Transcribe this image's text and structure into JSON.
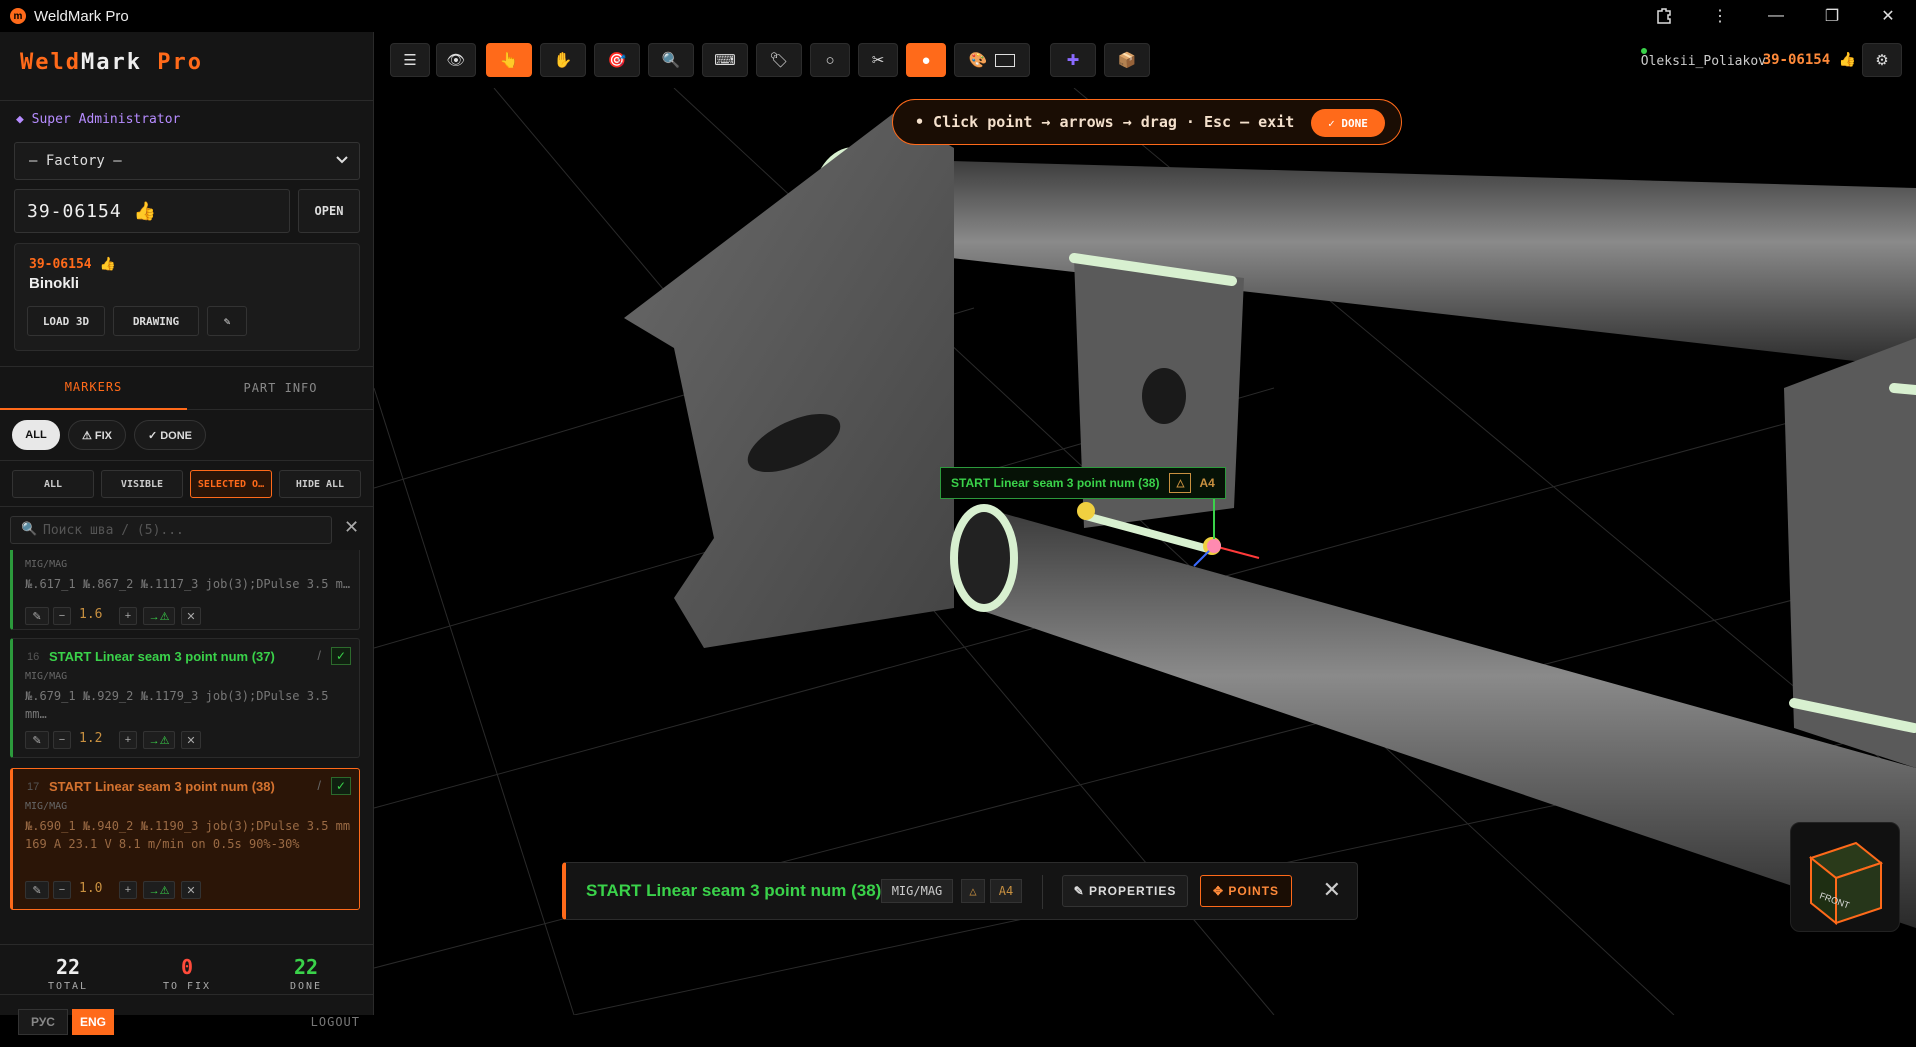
{
  "window": {
    "title": "WeldMark Pro",
    "controls": [
      "minimize",
      "maximize",
      "close"
    ]
  },
  "sidebar": {
    "brand": {
      "part1": "Weld",
      "part2": "Mark",
      "part3": " Pro"
    },
    "role": "◆ Super Administrator",
    "factory_select": "— Factory —",
    "order_input": "39-06154 👍",
    "open_label": "OPEN",
    "order_card": {
      "number": "39-06154 👍",
      "name": "Binokli",
      "load3d": "LOAD 3D",
      "drawing": "DRAWING",
      "edit": "✎"
    },
    "tabs": [
      {
        "label": "MARKERS",
        "active": true
      },
      {
        "label": "PART INFO",
        "active": false
      }
    ],
    "status_filters": [
      "ALL",
      "⚠ FIX",
      "✓ DONE"
    ],
    "visibility_filters": [
      "ALL",
      "VISIBLE",
      "SELECTED O…",
      "HIDE ALL"
    ],
    "search_placeholder": "Поиск шва / (5)...",
    "seams": [
      {
        "num": "",
        "title": "",
        "process": "MIG/MAG",
        "desc": "№.617_1 №.867_2 №.1117_3 job(3);DPulse 3.5 m…",
        "value": "1.6"
      },
      {
        "num": "16",
        "title": "START Linear seam 3 point num (37)",
        "process": "MIG/MAG",
        "desc": "№.679_1 №.929_2 №.1179_3 job(3);DPulse 3.5 mm…",
        "value": "1.2"
      },
      {
        "num": "17",
        "title": "START Linear seam 3 point num (38)",
        "process": "MIG/MAG",
        "desc": "№.690_1  №.940_2   №.1190_3   job(3);DPulse 3.5 mm   169 A  23.1 V  8.1 m/min     on 0.5s 90%-30%",
        "value": "1.0"
      }
    ],
    "stats": {
      "total": {
        "value": "22",
        "label": "TOTAL"
      },
      "to_fix": {
        "value": "0",
        "label": "TO FIX"
      },
      "done": {
        "value": "22",
        "label": "DONE"
      }
    },
    "langs": [
      "РУС",
      "ENG"
    ],
    "logout": "LOGOUT"
  },
  "toolbar": {
    "user": "Oleksii_Poliakov",
    "order": "39-06154 👍"
  },
  "viewport": {
    "hint": "• Click point → arrows → drag · Esc — exit",
    "hint_done": "✓ DONE",
    "label3d": "START Linear seam 3 point num (38)",
    "label3d_tag": "A4",
    "viewcube_face": "FRONT",
    "bottom": {
      "title": "START Linear seam 3 point num (38)",
      "process": "MIG/MAG",
      "grade": "A4",
      "properties": "✎ PROPERTIES",
      "points": "✥ POINTS"
    }
  },
  "colors": {
    "accent": "#ff6a1a",
    "done_green": "#3ad24a",
    "fix_red": "#ff4a3a"
  }
}
